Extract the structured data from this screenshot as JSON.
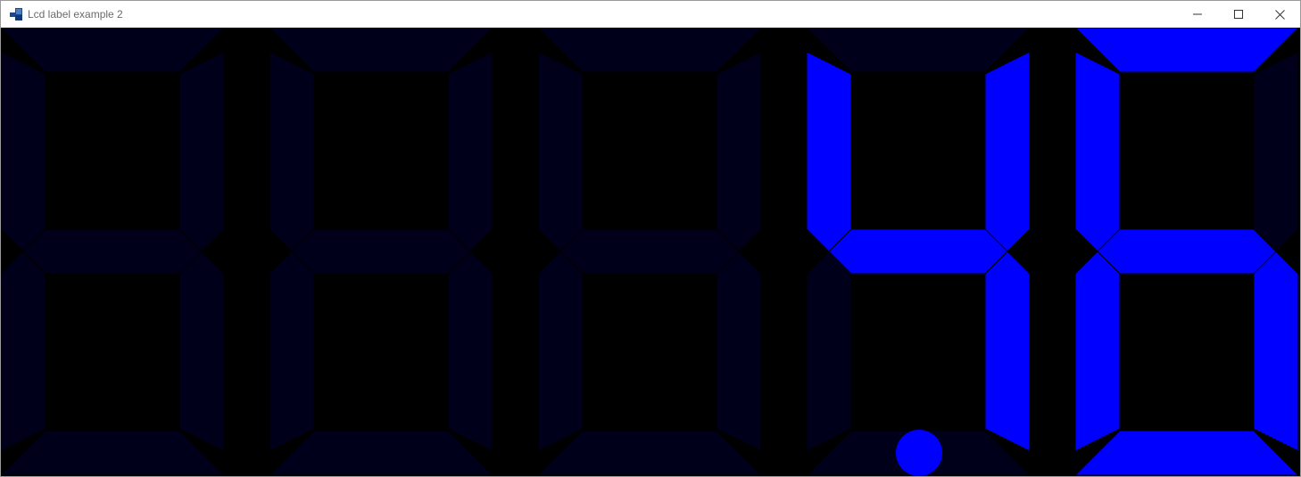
{
  "window": {
    "title": "Lcd label example 2",
    "icons": {
      "app": "app-icon",
      "minimize": "minimize-icon",
      "maximize": "maximize-icon",
      "close": "close-icon"
    }
  },
  "lcd": {
    "display_value": "46",
    "digit_count": 5,
    "decimal_point_after_digit": 4,
    "colors": {
      "background": "#000000",
      "segment_on": "#0000ff",
      "segment_off": "#00001a",
      "segment_separator": "#000000"
    }
  }
}
